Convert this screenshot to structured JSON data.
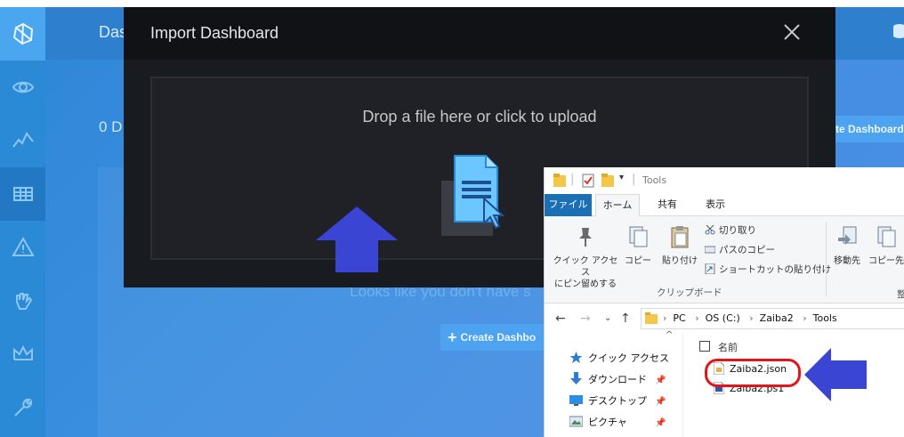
{
  "app": {
    "title": "Das",
    "count_text": "0 D",
    "create_button_top": "te Dashboard",
    "empty_message": "Looks like you don't have s",
    "create_button_bottom": "Create Dashbo",
    "sidebar": [
      "logo-icon",
      "eye-icon",
      "activity-icon",
      "table-icon",
      "alert-icon",
      "hand-icon",
      "crown-icon",
      "wrench-icon"
    ]
  },
  "modal": {
    "title": "Import Dashboard",
    "dropzone_text": "Drop a file here or click to upload",
    "close_icon": "close-icon"
  },
  "explorer": {
    "window_title": "Tools",
    "tabs": {
      "file": "ファイル",
      "home": "ホーム",
      "share": "共有",
      "view": "表示"
    },
    "ribbon": {
      "pin_quick_access": "クイック アクセス\nにピン留めする",
      "copy": "コピー",
      "paste": "貼り付け",
      "cut": "切り取り",
      "copy_path": "パスのコピー",
      "paste_shortcut": "ショートカットの貼り付け",
      "group_label": "クリップボード",
      "move_to": "移動先",
      "copy_to": "コピー先",
      "truncated_group": "整"
    },
    "address": [
      "PC",
      "OS (C:)",
      "Zaiba2",
      "Tools"
    ],
    "nav_items": [
      "クイック アクセス",
      "ダウンロード",
      "デスクトップ",
      "ピクチャ"
    ],
    "column_header": "名前",
    "files": [
      "Zaiba2.json",
      "Zaiba2.ps1"
    ]
  },
  "colors": {
    "app_blue": "#3a8ee0",
    "modal_bg": "#181b1f",
    "annotation_arrow": "#3a45d4",
    "highlight": "#e4141c",
    "explorer_file_tab": "#1a6fb5"
  }
}
